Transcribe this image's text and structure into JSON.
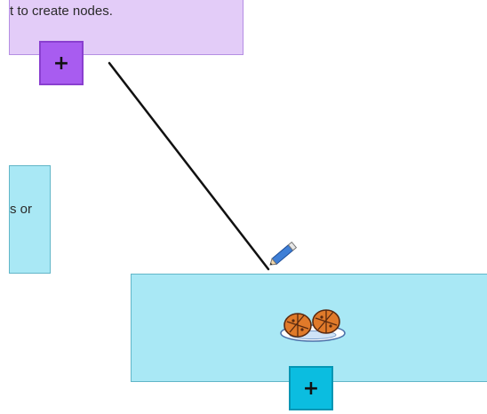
{
  "canvas": {
    "nodes": {
      "top": {
        "text": "t to create nodes.",
        "add_label": "+",
        "color": "#e3ccf8",
        "add_color": "#a85cf0"
      },
      "left": {
        "text": "s or",
        "color": "#a9e8f5"
      },
      "main": {
        "image": "cookies-on-plate",
        "add_label": "+",
        "color": "#a9e8f5",
        "add_color": "#0bbde0"
      }
    },
    "connector_color": "#111111",
    "cursor": "pencil-icon"
  }
}
